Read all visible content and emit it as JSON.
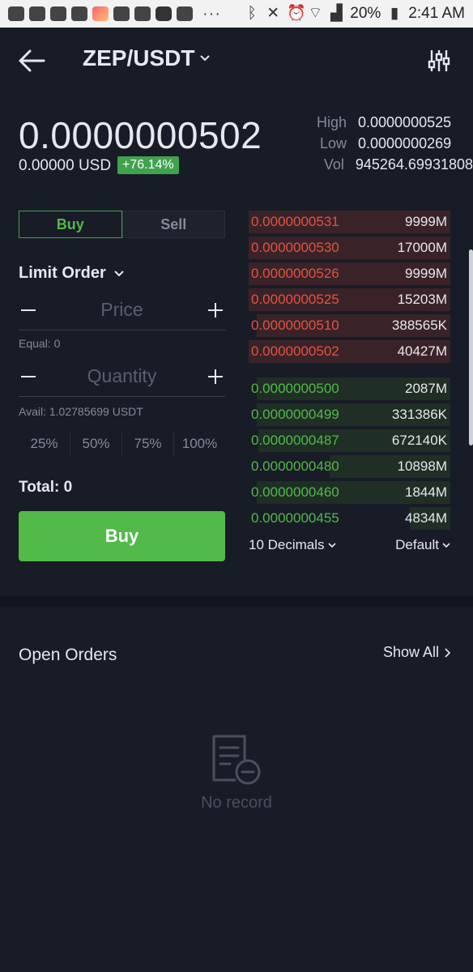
{
  "status_bar": {
    "battery": "20%",
    "time": "2:41 AM",
    "more": "···"
  },
  "header": {
    "pair": "ZEP/USDT"
  },
  "ticker": {
    "price": "0.0000000502",
    "usd": "0.00000 USD",
    "change": "+76.14%",
    "high_label": "High",
    "high": "0.0000000525",
    "low_label": "Low",
    "low": "0.0000000269",
    "vol_label": "Vol",
    "vol": "945264.69931808"
  },
  "trade": {
    "tab_buy": "Buy",
    "tab_sell": "Sell",
    "order_type": "Limit Order",
    "price_placeholder": "Price",
    "equal": "Equal: 0",
    "quantity_placeholder": "Quantity",
    "avail": "Avail: 1.02785699 USDT",
    "pct": [
      "25%",
      "50%",
      "75%",
      "100%"
    ],
    "total": "Total: 0",
    "buy_button": "Buy"
  },
  "orderbook": {
    "asks": [
      {
        "price": "0.0000000531",
        "amount": "9999M",
        "depth": 1.0
      },
      {
        "price": "0.0000000530",
        "amount": "17000M",
        "depth": 1.0
      },
      {
        "price": "0.0000000526",
        "amount": "9999M",
        "depth": 1.0
      },
      {
        "price": "0.0000000525",
        "amount": "15203M",
        "depth": 1.0
      },
      {
        "price": "0.0000000510",
        "amount": "388565K",
        "depth": 0.96
      },
      {
        "price": "0.0000000502",
        "amount": "40427M",
        "depth": 1.0
      }
    ],
    "bids": [
      {
        "price": "0.0000000500",
        "amount": "2087M",
        "depth": 0.96
      },
      {
        "price": "0.0000000499",
        "amount": "331386K",
        "depth": 0.96
      },
      {
        "price": "0.0000000487",
        "amount": "672140K",
        "depth": 0.95
      },
      {
        "price": "0.0000000480",
        "amount": "10898M",
        "depth": 0.6
      },
      {
        "price": "0.0000000460",
        "amount": "1844M",
        "depth": 0.96
      },
      {
        "price": "0.0000000455",
        "amount": "4834M",
        "depth": 0.2
      }
    ],
    "decimals": "10 Decimals",
    "mode": "Default"
  },
  "open_orders": {
    "title": "Open Orders",
    "show_all": "Show All",
    "empty": "No record"
  }
}
